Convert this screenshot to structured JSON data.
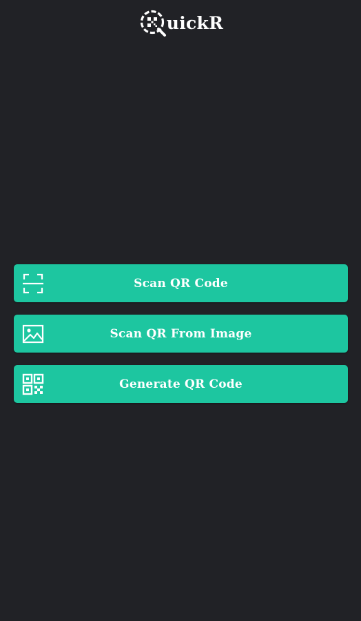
{
  "app": {
    "logo_text": "uickR",
    "logo_icon": "qr-scan-q-logo-icon"
  },
  "actions": [
    {
      "label": "Scan QR Code",
      "icon": "scan-frame-icon"
    },
    {
      "label": "Scan QR From Image",
      "icon": "image-icon"
    },
    {
      "label": "Generate QR Code",
      "icon": "qr-code-icon"
    }
  ],
  "colors": {
    "background": "#212226",
    "accent": "#1dc6a0",
    "text": "#ffffff"
  }
}
